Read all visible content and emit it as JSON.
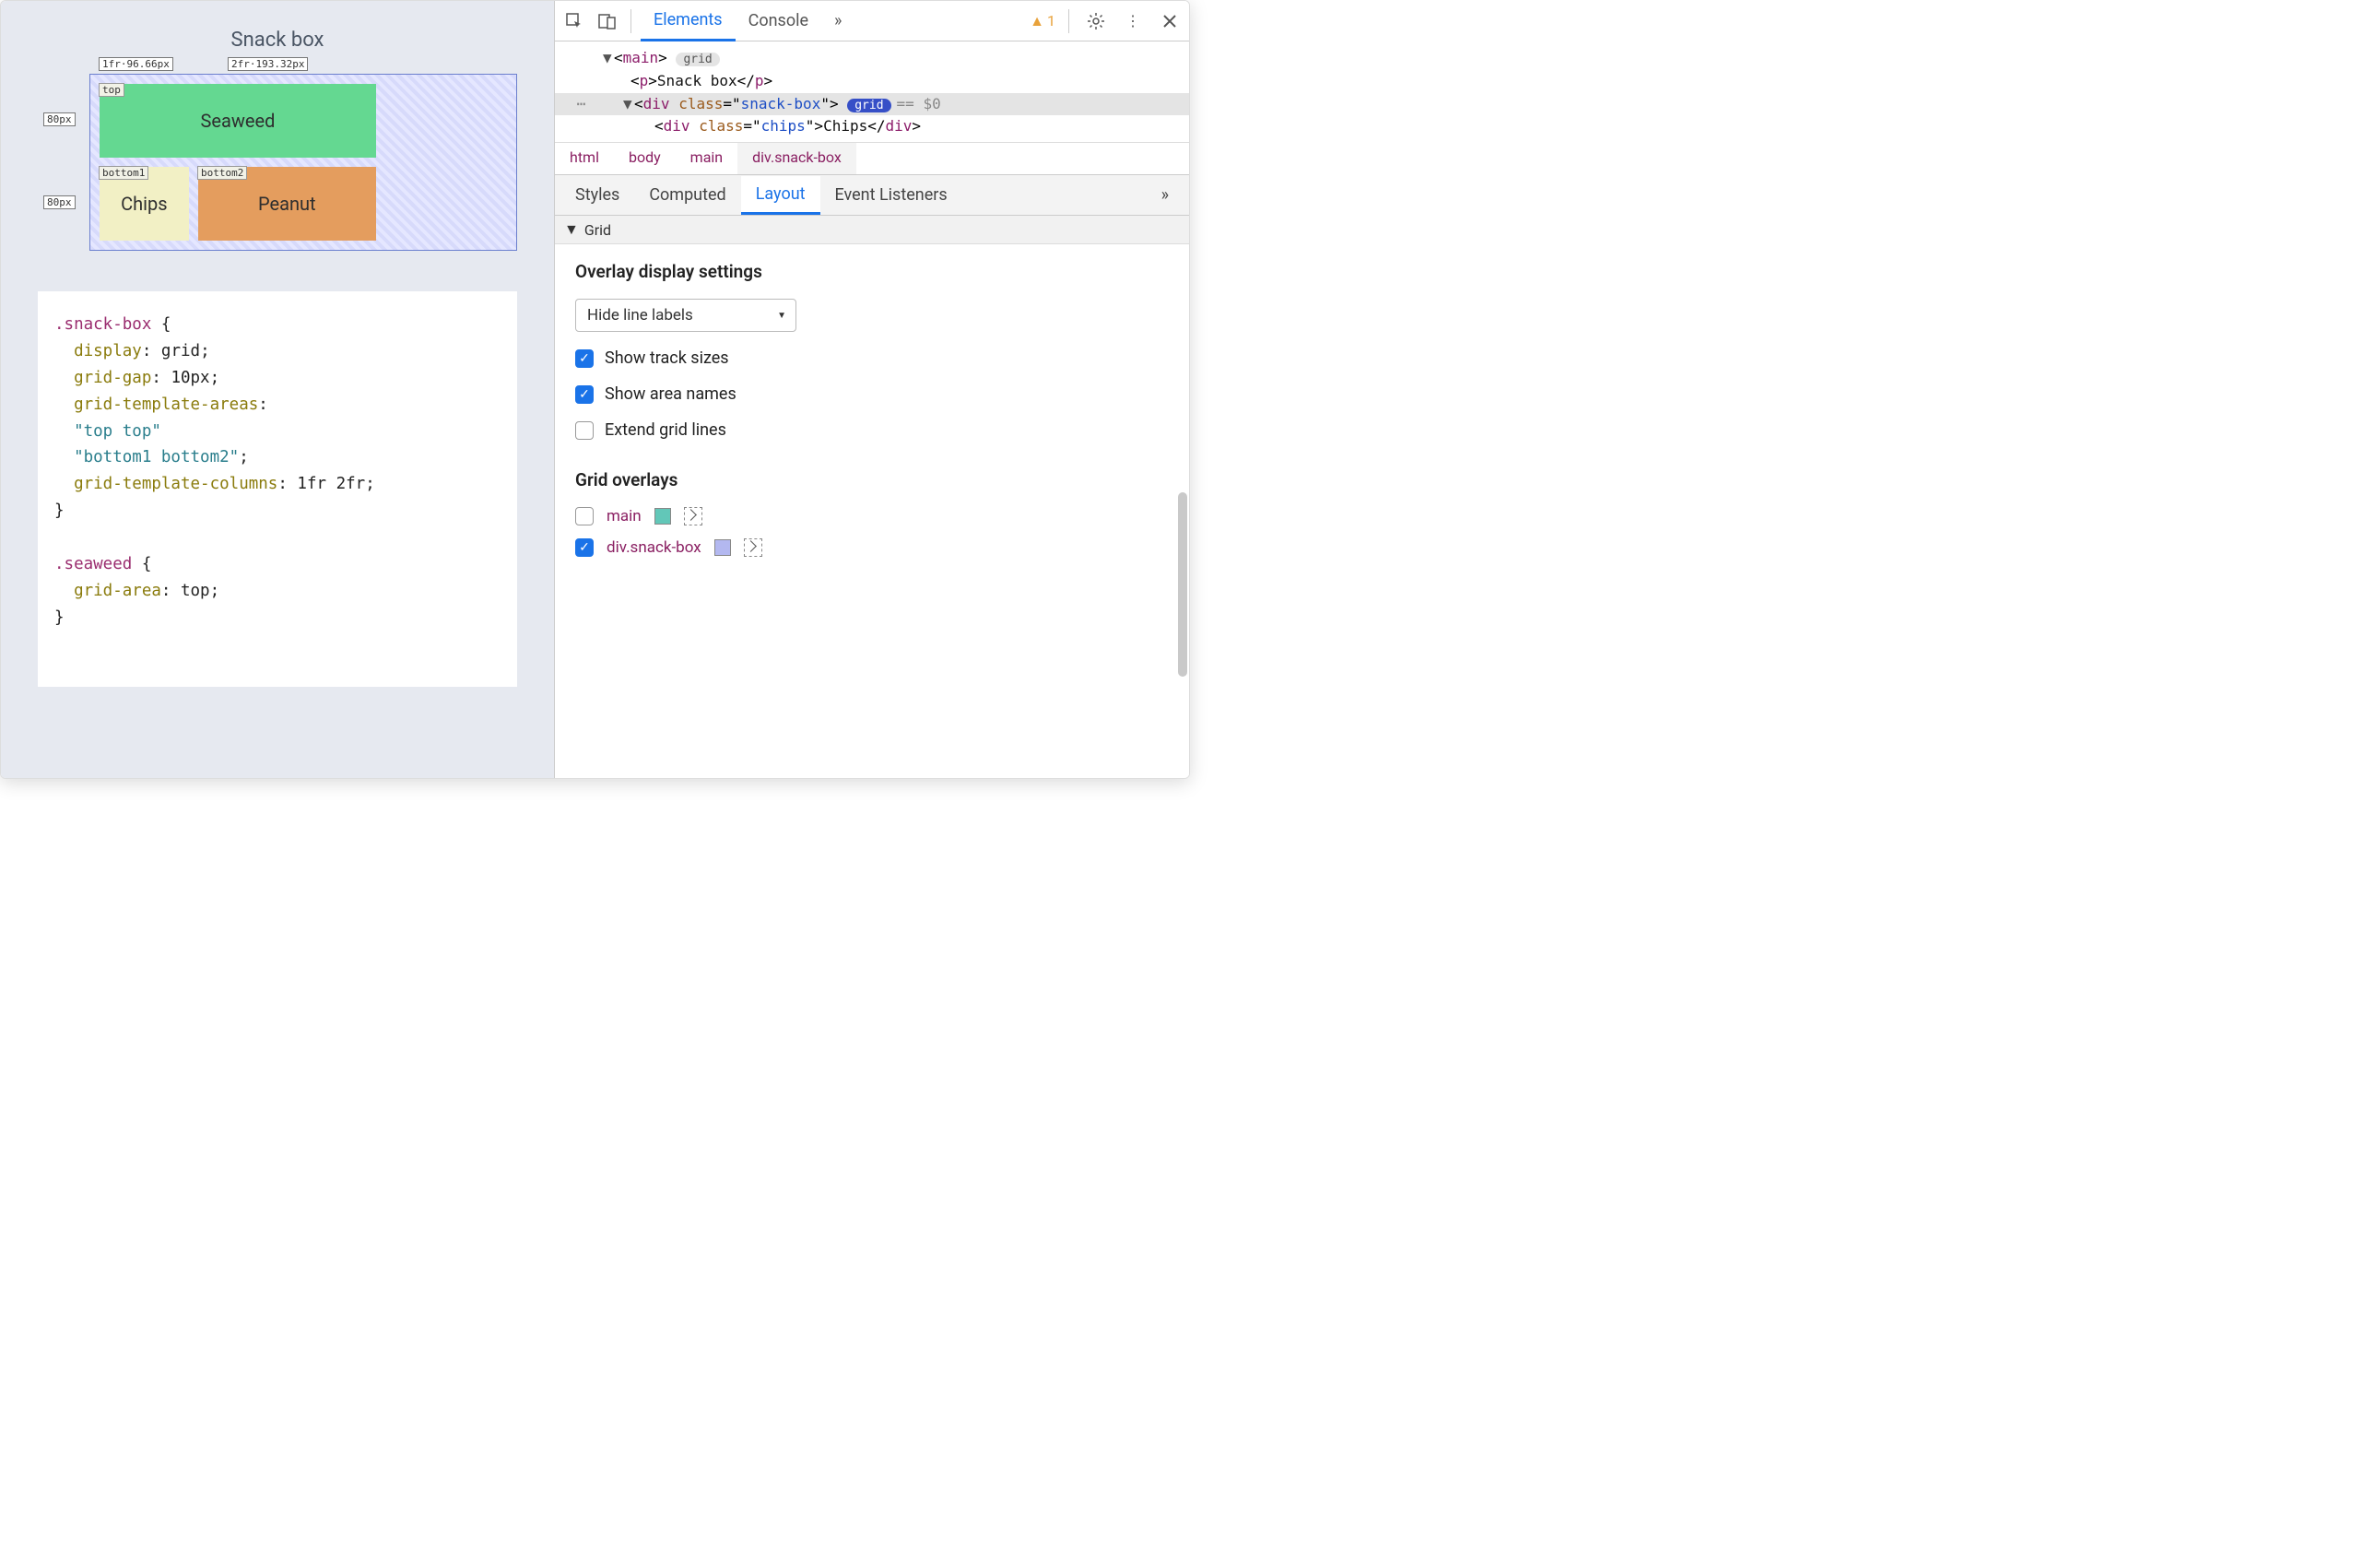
{
  "viewport": {
    "title": "Snack box",
    "col_labels": [
      "1fr·96.66px",
      "2fr·193.32px"
    ],
    "row_labels": [
      "80px",
      "80px"
    ],
    "area_labels": [
      "top",
      "bottom1",
      "bottom2"
    ],
    "cells": {
      "seaweed": "Seaweed",
      "chips": "Chips",
      "peanut": "Peanut"
    },
    "code": {
      "sel1": ".snack-box",
      "l1_prop": "display",
      "l1_val": "grid",
      "l2_prop": "grid-gap",
      "l2_val": "10px",
      "l3_prop": "grid-template-areas",
      "l3_str1": "\"top top\"",
      "l3_str2": "\"bottom1 bottom2\"",
      "l4_prop": "grid-template-columns",
      "l4_val": "1fr 2fr",
      "sel2": ".seaweed",
      "l5_prop": "grid-area",
      "l5_val": "top",
      "brace_open": " {",
      "brace_close": "}"
    }
  },
  "toolbar": {
    "tabs": {
      "elements": "Elements",
      "console": "Console",
      "more": "»"
    },
    "warning_count": "1"
  },
  "dom": {
    "main_tag": "main",
    "main_badge": "grid",
    "p_tag": "p",
    "p_text": "Snack box",
    "div_tag": "div",
    "class_attr": "class",
    "snack_val": "snack-box",
    "snack_badge": "grid",
    "selected_marker": "== $0",
    "chips_val": "chips",
    "chips_text": "Chips"
  },
  "crumbs": [
    "html",
    "body",
    "main",
    "div.snack-box"
  ],
  "subtabs": {
    "styles": "Styles",
    "computed": "Computed",
    "layout": "Layout",
    "events": "Event Listeners",
    "more": "»"
  },
  "layout_panel": {
    "section": "Grid",
    "overlay_settings_title": "Overlay display settings",
    "select_value": "Hide line labels",
    "opt_track": "Show track sizes",
    "opt_area": "Show area names",
    "opt_extend": "Extend grid lines",
    "overlays_title": "Grid overlays",
    "overlays": [
      {
        "name": "main",
        "color": "#62c7b8",
        "checked": false
      },
      {
        "name": "div.snack-box",
        "color": "#b3b8f0",
        "checked": true
      }
    ]
  }
}
